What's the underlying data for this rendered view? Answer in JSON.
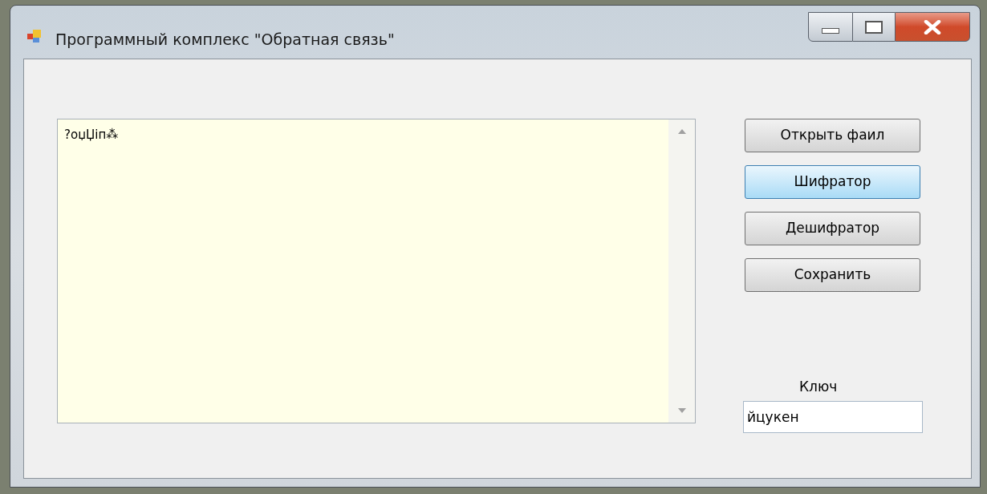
{
  "window": {
    "title": "Программный комплекс \"Обратная связь\""
  },
  "text_area": {
    "value": "?oџЏіп⁂"
  },
  "buttons": [
    {
      "label": "Открыть фаил",
      "hovered": false
    },
    {
      "label": "Шифратор",
      "hovered": true
    },
    {
      "label": "Дешифратор",
      "hovered": false
    },
    {
      "label": "Сохранить",
      "hovered": false
    }
  ],
  "key": {
    "label": "Ключ",
    "value": "йцукен"
  }
}
